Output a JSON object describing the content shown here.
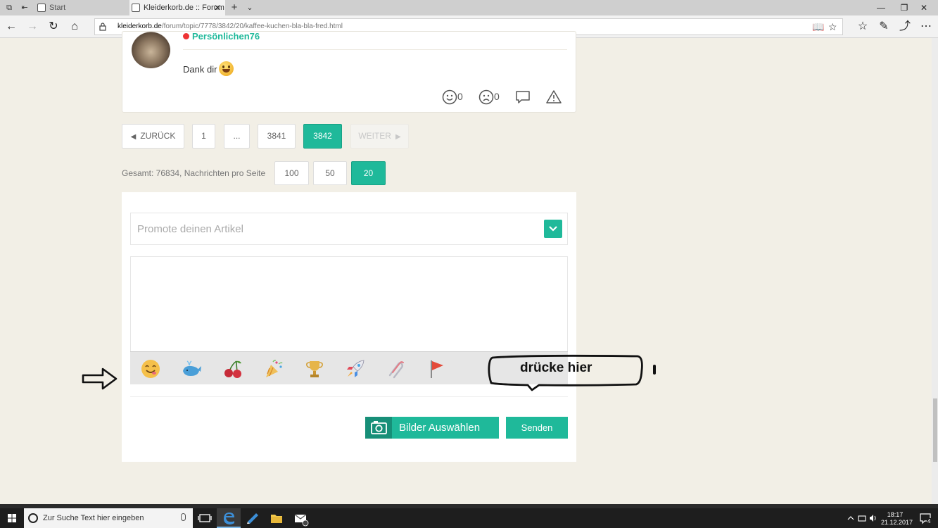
{
  "browser": {
    "tabs": [
      {
        "label": "Start"
      },
      {
        "label": "Kleiderkorb.de :: Forum"
      }
    ],
    "url_domain": "kleiderkorb.de",
    "url_path": "/forum/topic/7778/3842/20/kaffee-kuchen-bla-bla-fred.html"
  },
  "post": {
    "username": "Persönlichen76",
    "text": "Dank dir",
    "like_count": "0",
    "dislike_count": "0"
  },
  "pagination": {
    "back_label": "ZURÜCK",
    "pages": [
      "1",
      "...",
      "3841",
      "3842"
    ],
    "next_label": "WEITER",
    "total_label": "Gesamt: 76834, Nachrichten pro Seite",
    "per_page_options": [
      "100",
      "50",
      "20"
    ]
  },
  "editor": {
    "promote_placeholder": "Promote deinen Artikel",
    "images_button": "Bilder Auswählen",
    "send_button": "Senden",
    "emoji_categories": [
      "smiley",
      "animal",
      "food",
      "celebration",
      "trophy",
      "travel",
      "objects",
      "flag"
    ]
  },
  "annotation": {
    "bubble_text": "drücke hier"
  },
  "taskbar": {
    "search_placeholder": "Zur Suche Text hier eingeben",
    "time": "18:17",
    "date": "21.12.2017",
    "notification_count": "4"
  },
  "colors": {
    "accent": "#1fb99a",
    "accent_dark": "#178f78",
    "page_bg": "#f2efe6"
  }
}
